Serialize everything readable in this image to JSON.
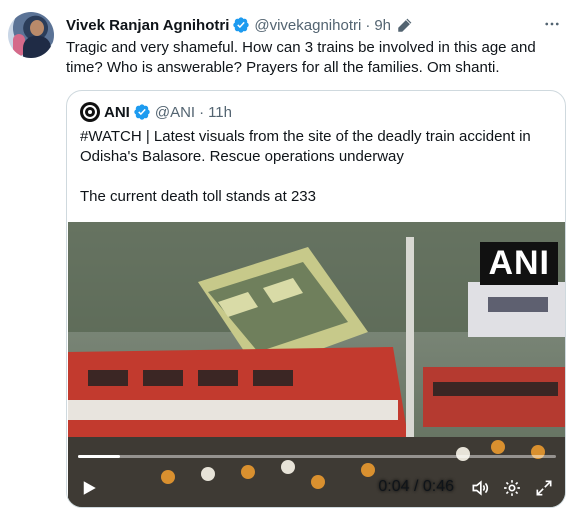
{
  "tweet": {
    "author_name": "Vivek Ranjan Agnihotri",
    "handle": "@vivekagnihotri",
    "separator": "·",
    "time": "9h",
    "text": "Tragic and very shameful. How can 3 trains be involved in this age and time? Who is answerable? Prayers for all the families. Om shanti."
  },
  "quote": {
    "author_name": "ANI",
    "handle": "@ANI",
    "separator": "·",
    "time": "11h",
    "text_line1": "#WATCH | Latest visuals from the site of the deadly train accident in Odisha's Balasore. Rescue operations underway",
    "text_line2": "The current death toll stands at 233"
  },
  "video": {
    "watermark": "ANI",
    "current_time": "0:04",
    "duration": "0:46",
    "time_separator": " / ",
    "progress_fraction": 0.087
  },
  "icons": {
    "verified": "verified-badge-icon",
    "edit": "edit-pencil-icon",
    "more": "more-icon",
    "play": "play-icon",
    "volume": "volume-icon",
    "settings": "settings-gear-icon",
    "fullscreen": "fullscreen-icon"
  },
  "colors": {
    "verified_blue": "#1d9bf0",
    "secondary_text": "#536471",
    "border": "#cfd9de"
  }
}
